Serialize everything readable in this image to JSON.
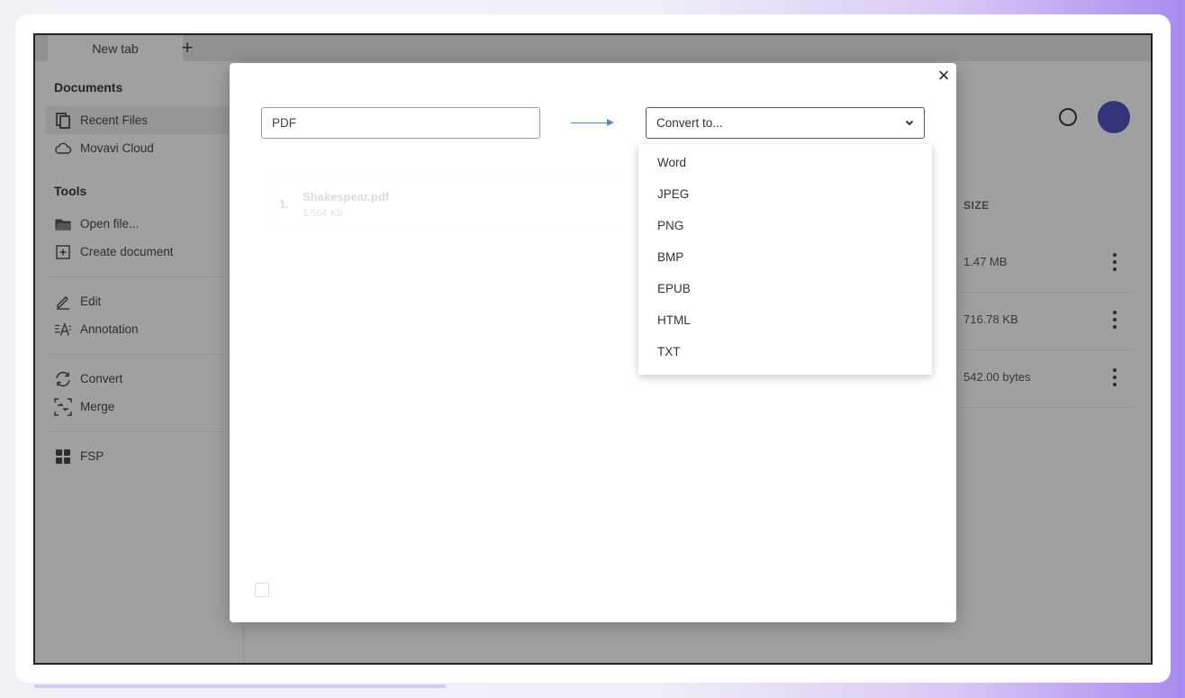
{
  "tabs": {
    "active_label": "New tab",
    "new_tab_symbol": "+"
  },
  "sidebar": {
    "documents_title": "Documents",
    "documents_items": [
      {
        "label": "Recent Files",
        "icon": "document-icon",
        "active": true
      },
      {
        "label": "Movavi Cloud",
        "icon": "cloud-icon",
        "active": false
      }
    ],
    "tools_title": "Tools",
    "tools_items": [
      {
        "label": "Open file...",
        "icon": "folder-icon"
      },
      {
        "label": "Create document",
        "icon": "add-document-icon"
      }
    ],
    "edit_items": [
      {
        "label": "Edit",
        "icon": "pencil-icon"
      },
      {
        "label": "Annotation",
        "icon": "annotation-icon"
      }
    ],
    "convert_items": [
      {
        "label": "Convert",
        "icon": "convert-icon"
      },
      {
        "label": "Merge",
        "icon": "merge-icon"
      }
    ],
    "extra_items": [
      {
        "label": "FSP",
        "icon": "grid-icon"
      }
    ]
  },
  "file_list": {
    "size_header": "SIZE",
    "rows": [
      {
        "size": "1.47 MB"
      },
      {
        "size": "716.78 KB"
      },
      {
        "size": "542.00 bytes"
      }
    ]
  },
  "modal": {
    "close_symbol": "×",
    "source_format": "PDF",
    "convert_placeholder": "Convert to...",
    "format_options": [
      "Word",
      "JPEG",
      "PNG",
      "BMP",
      "EPUB",
      "HTML",
      "TXT"
    ],
    "file_card": {
      "index": "1.",
      "name": "Shakespear.pdf",
      "meta": "1.564 Kb"
    }
  },
  "colors": {
    "avatar": "#3a3fb0",
    "arrow": "#5a86c7"
  }
}
